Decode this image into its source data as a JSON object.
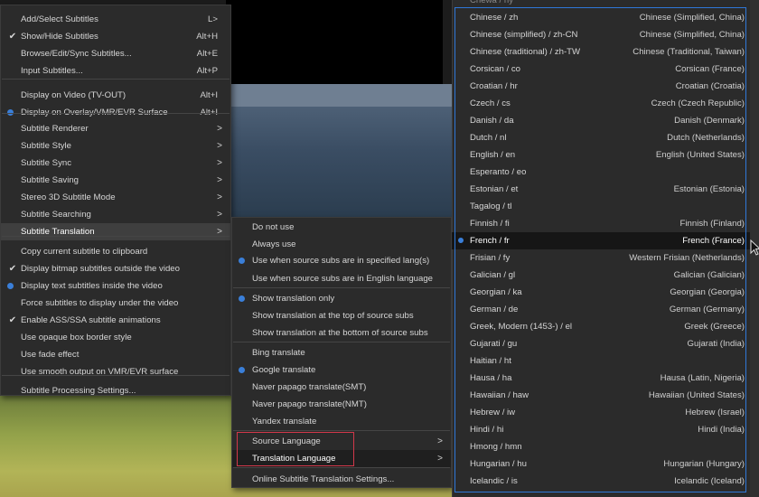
{
  "main_menu": {
    "items": [
      {
        "label": "Add/Select Subtitles",
        "shortcut": "L>",
        "mark": ""
      },
      {
        "label": "Show/Hide Subtitles",
        "shortcut": "Alt+H",
        "mark": "check"
      },
      {
        "label": "Browse/Edit/Sync Subtitles...",
        "shortcut": "Alt+E",
        "mark": ""
      },
      {
        "label": "Input Subtitles...",
        "shortcut": "Alt+P",
        "mark": ""
      },
      {
        "label": "Display on Video (TV-OUT)",
        "shortcut": "Alt+I",
        "mark": ""
      },
      {
        "label": "Display on Overlay/VMR/EVR Surface",
        "shortcut": "Alt+I",
        "mark": "dot"
      },
      {
        "label": "Subtitle Renderer",
        "shortcut": ">",
        "mark": ""
      },
      {
        "label": "Subtitle Style",
        "shortcut": ">",
        "mark": ""
      },
      {
        "label": "Subtitle Sync",
        "shortcut": ">",
        "mark": ""
      },
      {
        "label": "Subtitle Saving",
        "shortcut": ">",
        "mark": ""
      },
      {
        "label": "Stereo 3D Subtitle Mode",
        "shortcut": ">",
        "mark": ""
      },
      {
        "label": "Subtitle Searching",
        "shortcut": ">",
        "mark": ""
      },
      {
        "label": "Subtitle Translation",
        "shortcut": ">",
        "mark": ""
      },
      {
        "label": "Copy current subtitle to clipboard",
        "shortcut": "",
        "mark": ""
      },
      {
        "label": "Display bitmap subtitles outside the video",
        "shortcut": "",
        "mark": "check"
      },
      {
        "label": "Display text subtitles inside the video",
        "shortcut": "",
        "mark": "dot"
      },
      {
        "label": "Force subtitles to display under the video",
        "shortcut": "",
        "mark": ""
      },
      {
        "label": "Enable ASS/SSA subtitle animations",
        "shortcut": "",
        "mark": "check"
      },
      {
        "label": "Use opaque box border style",
        "shortcut": "",
        "mark": ""
      },
      {
        "label": "Use fade effect",
        "shortcut": "",
        "mark": ""
      },
      {
        "label": "Use smooth output on VMR/EVR surface",
        "shortcut": "",
        "mark": ""
      },
      {
        "label": "Subtitle Processing Settings...",
        "shortcut": "",
        "mark": ""
      }
    ]
  },
  "translation_menu": {
    "items": [
      {
        "label": "Do not use",
        "mark": ""
      },
      {
        "label": "Always use",
        "mark": ""
      },
      {
        "label": "Use when source subs are in specified lang(s)",
        "mark": "dot"
      },
      {
        "label": "Use when source subs are in English language",
        "mark": ""
      },
      {
        "label": "Show translation only",
        "mark": "dot"
      },
      {
        "label": "Show translation at the top of source subs",
        "mark": ""
      },
      {
        "label": "Show translation at the bottom of source subs",
        "mark": ""
      },
      {
        "label": "Bing translate",
        "mark": ""
      },
      {
        "label": "Google translate",
        "mark": "dot"
      },
      {
        "label": "Naver papago translate(SMT)",
        "mark": ""
      },
      {
        "label": "Naver papago translate(NMT)",
        "mark": ""
      },
      {
        "label": "Yandex translate",
        "mark": ""
      },
      {
        "label": "Source Language",
        "mark": "",
        "arrow": ">"
      },
      {
        "label": "Translation Language",
        "mark": "",
        "arrow": ">"
      },
      {
        "label": "Online Subtitle Translation Settings...",
        "mark": ""
      }
    ]
  },
  "language_list": {
    "partial_top": "Chewa / ny",
    "items": [
      {
        "code": "Chinese / zh",
        "region": "Chinese (Simplified, China)"
      },
      {
        "code": "Chinese (simplified) / zh-CN",
        "region": "Chinese (Simplified, China)"
      },
      {
        "code": "Chinese (traditional) / zh-TW",
        "region": "Chinese (Traditional, Taiwan)"
      },
      {
        "code": "Corsican / co",
        "region": "Corsican (France)"
      },
      {
        "code": "Croatian / hr",
        "region": "Croatian (Croatia)"
      },
      {
        "code": "Czech / cs",
        "region": "Czech (Czech Republic)"
      },
      {
        "code": "Danish / da",
        "region": "Danish (Denmark)"
      },
      {
        "code": "Dutch / nl",
        "region": "Dutch (Netherlands)"
      },
      {
        "code": "English / en",
        "region": "English (United States)"
      },
      {
        "code": "Esperanto / eo",
        "region": ""
      },
      {
        "code": "Estonian / et",
        "region": "Estonian (Estonia)"
      },
      {
        "code": "Tagalog / tl",
        "region": ""
      },
      {
        "code": "Finnish / fi",
        "region": "Finnish (Finland)"
      },
      {
        "code": "French / fr",
        "region": "French (France)",
        "selected": true
      },
      {
        "code": "Frisian / fy",
        "region": "Western Frisian (Netherlands)"
      },
      {
        "code": "Galician / gl",
        "region": "Galician (Galician)"
      },
      {
        "code": "Georgian / ka",
        "region": "Georgian (Georgia)"
      },
      {
        "code": "German / de",
        "region": "German (Germany)"
      },
      {
        "code": "Greek, Modern (1453-) / el",
        "region": "Greek (Greece)"
      },
      {
        "code": "Gujarati / gu",
        "region": "Gujarati (India)"
      },
      {
        "code": "Haitian / ht",
        "region": ""
      },
      {
        "code": "Hausa / ha",
        "region": "Hausa (Latin, Nigeria)"
      },
      {
        "code": "Hawaiian / haw",
        "region": "Hawaiian (United States)"
      },
      {
        "code": "Hebrew / iw",
        "region": "Hebrew (Israel)"
      },
      {
        "code": "Hindi / hi",
        "region": "Hindi (India)"
      },
      {
        "code": "Hmong / hmn",
        "region": ""
      },
      {
        "code": "Hungarian / hu",
        "region": "Hungarian (Hungary)"
      },
      {
        "code": "Icelandic / is",
        "region": "Icelandic (Iceland)"
      }
    ]
  },
  "colors": {
    "menu_bg": "#2b2b2b",
    "accent_blue": "#3a7fd9",
    "highlight_red": "#d2384a"
  }
}
